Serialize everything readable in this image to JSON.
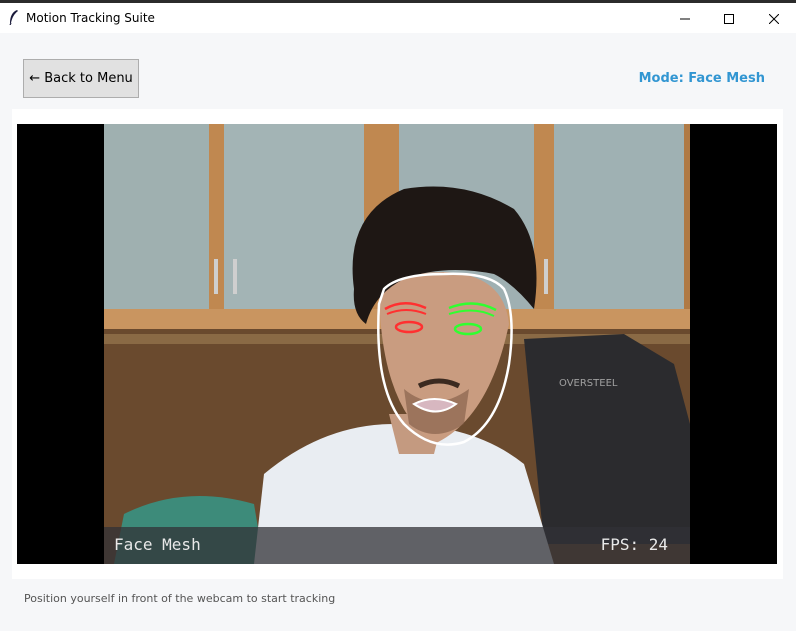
{
  "window": {
    "title": "Motion Tracking Suite"
  },
  "toolbar": {
    "back_label": "← Back to Menu",
    "mode_label": "Mode: Face Mesh",
    "mode_color": "#3296d2"
  },
  "video": {
    "overlay_mode": "Face Mesh",
    "overlay_fps": "FPS: 24"
  },
  "status": {
    "message": "Position yourself in front of the webcam to start tracking"
  },
  "icons": {
    "app": "feather-icon",
    "minimize": "minimize-icon",
    "maximize": "maximize-icon",
    "close": "close-icon"
  },
  "colors": {
    "left_eye_landmarks": "#ff3030",
    "right_eye_landmarks": "#30ff30",
    "face_outline": "#ffffff"
  }
}
